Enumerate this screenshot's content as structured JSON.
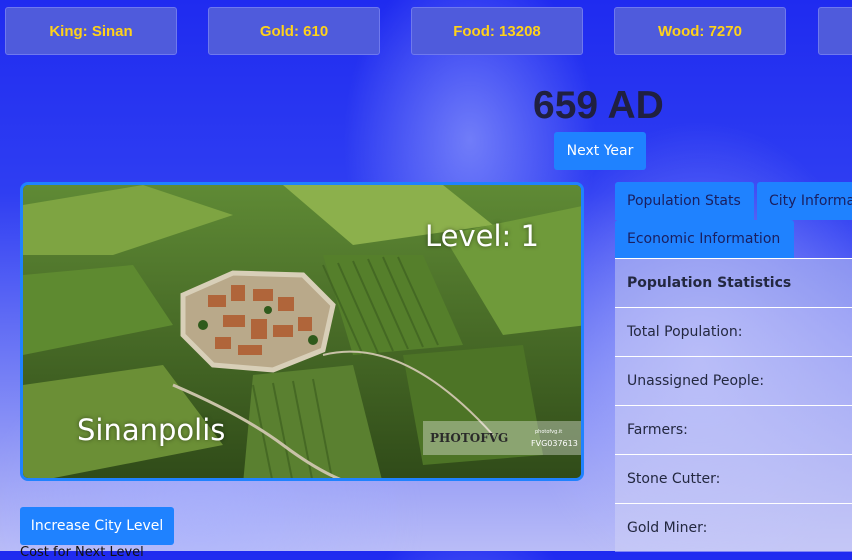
{
  "stats": {
    "king": "King: Sinan",
    "gold": "Gold: 610",
    "food": "Food: 13208",
    "wood": "Wood: 7270"
  },
  "year": "659 AD",
  "next_year_label": "Next Year",
  "city": {
    "name": "Sinanpolis",
    "level_label": "Level: 1",
    "watermark_brand": "PHOTOFVG",
    "watermark_code": "FVG037613",
    "watermark_small": "photofvg.it",
    "increase_level_label": "Increase City Level",
    "cost_note": "Cost for Next Level"
  },
  "tabs": [
    {
      "label": "Population Stats"
    },
    {
      "label": "City Information"
    },
    {
      "label": "Economic Information"
    }
  ],
  "population_table": {
    "header": "Population Statistics",
    "rows": [
      {
        "label": "Total Population:"
      },
      {
        "label": "Unassigned People:"
      },
      {
        "label": "Farmers:"
      },
      {
        "label": "Stone Cutter:"
      },
      {
        "label": "Gold Miner:"
      }
    ]
  },
  "colors": {
    "accent": "#1f82ff",
    "stat_text": "#ffd21a",
    "stat_bg": "#4f5bdc"
  }
}
